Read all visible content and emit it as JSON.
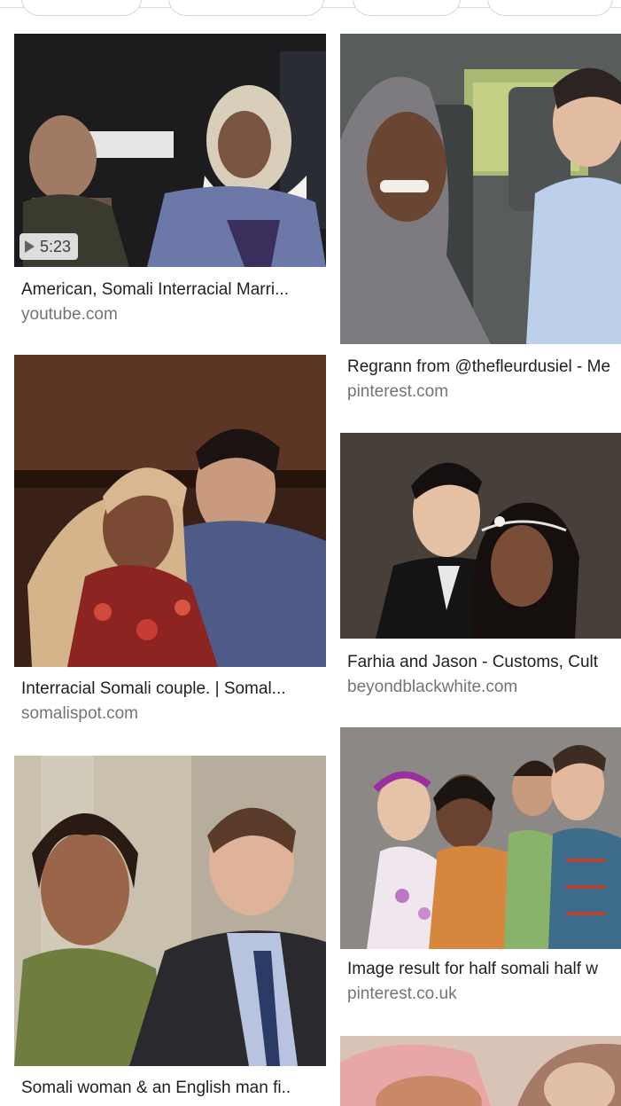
{
  "results": [
    {
      "title": "American, Somali Interracial Marri...",
      "source": "youtube.com",
      "duration": "5:23"
    },
    {
      "title": "Regrann from @thefleurdusiel - Me",
      "source": "pinterest.com"
    },
    {
      "title": "Interracial Somali couple. | Somal...",
      "source": "somalispot.com"
    },
    {
      "title": "Farhia and Jason - Customs, Cult",
      "source": "beyondblackwhite.com"
    },
    {
      "title": "Somali woman & an English man fi..",
      "source": ""
    },
    {
      "title": "Image result for half somali half w",
      "source": "pinterest.co.uk"
    }
  ]
}
